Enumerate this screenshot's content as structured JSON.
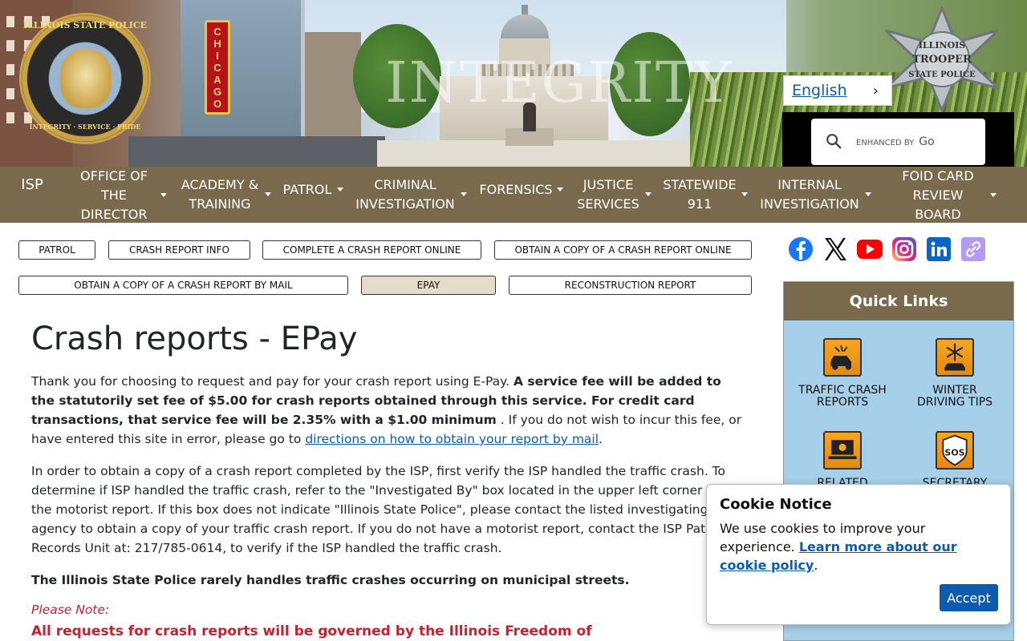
{
  "banner": {
    "watermark": "INTEGRITY",
    "seal": {
      "top_text": "ILLINOIS STATE POLICE",
      "bottom_text": "INTEGRITY · SERVICE · PRIDE"
    },
    "badge": {
      "line1": "ILLINOIS",
      "line2": "TROOPER",
      "line3": "STATE POLICE"
    },
    "sign": "CHICAGO"
  },
  "language": {
    "label": "English"
  },
  "search": {
    "placeholder": "ENHANCED BY",
    "brand": "Go"
  },
  "nav": {
    "items": [
      {
        "label": "ISP"
      },
      {
        "label": "OFFICE OF THE DIRECTOR"
      },
      {
        "label": "ACADEMY & TRAINING"
      },
      {
        "label": "PATROL"
      },
      {
        "label": "CRIMINAL INVESTIGATION"
      },
      {
        "label": "FORENSICS"
      },
      {
        "label": "JUSTICE SERVICES"
      },
      {
        "label": "STATEWIDE 911"
      },
      {
        "label": "INTERNAL INVESTIGATION"
      },
      {
        "label": "FOID CARD REVIEW BOARD"
      }
    ]
  },
  "subnav": {
    "items": [
      {
        "label": "PATROL"
      },
      {
        "label": "CRASH REPORT INFO"
      },
      {
        "label": "COMPLETE A CRASH REPORT ONLINE"
      },
      {
        "label": "OBTAIN A COPY OF A CRASH REPORT ONLINE"
      },
      {
        "label": "OBTAIN A COPY OF A CRASH REPORT BY MAIL"
      },
      {
        "label": "EPAY"
      },
      {
        "label": "RECONSTRUCTION REPORT"
      }
    ]
  },
  "main": {
    "title": "Crash reports - EPay",
    "p1_start": "Thank you for choosing to request and pay for your crash report using E-Pay.",
    "p1_bold": "A service fee will be added to the statutorily set fee of $5.00 for crash reports obtained through this service. For credit card transactions, that service fee will be 2.35% with a $1.00 minimum",
    "p1_mid": ". If you do not wish to incur this fee, or have entered this site in error, please go to",
    "p1_link": "directions on how to obtain your report by mail",
    "p1_end": ".",
    "p2": "In order to obtain a copy of a crash report completed by the ISP, first verify the ISP handled the traffic crash. To determine if ISP handled the traffic crash, refer to the \"Investigated By\" box located in the upper left corner of the motorist report. If this box does not indicate \"Illinois State Police\", please contact the listed investigating agency to obtain a copy of your traffic crash report. If you do not have a motorist report, contact the ISP Patrol Records Unit at: 217/785-0614, to verify if the ISP handled the traffic crash.",
    "p3": "The Illinois State Police rarely handles traffic crashes occurring on municipal streets.",
    "note_label": "Please Note:",
    "note_text": "All requests for crash reports will be governed by the Illinois Freedom of"
  },
  "social": {
    "icons": [
      "facebook-icon",
      "x-icon",
      "youtube-icon",
      "instagram-icon",
      "linkedin-icon",
      "link-icon"
    ]
  },
  "quick_links": {
    "title": "Quick Links",
    "items": [
      {
        "label": "TRAFFIC CRASH REPORTS",
        "icon": "crash-car-icon"
      },
      {
        "label": "WINTER DRIVING TIPS",
        "icon": "snowflake-car-icon"
      },
      {
        "label": "RELATED",
        "icon": "laptop-icon"
      },
      {
        "label": "SECRETARY",
        "icon": "sos-icon"
      }
    ]
  },
  "cookie": {
    "title": "Cookie Notice",
    "text": "We use cookies to improve your experience.",
    "link": "Learn more about our cookie policy",
    "end": ".",
    "accept": "Accept"
  },
  "colors": {
    "nav_bg": "#7a6a4d",
    "link": "#0b5cad",
    "note_red": "#c8202f",
    "quick_links_bg": "#a6d0ea",
    "active_pill": "#e4dbc9"
  }
}
